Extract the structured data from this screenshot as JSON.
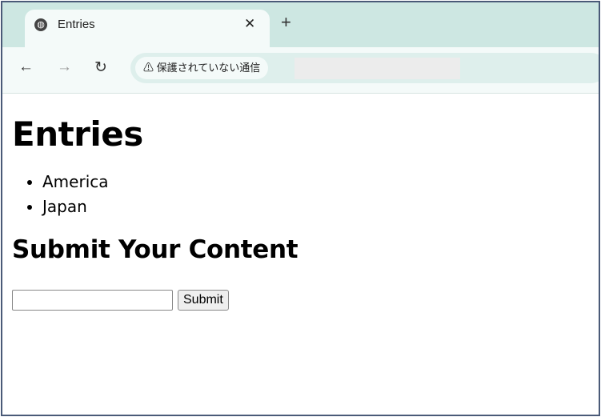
{
  "browser": {
    "tab_title": "Entries",
    "security_label": "保護されていない通信",
    "address": ""
  },
  "page": {
    "heading": "Entries",
    "entries": [
      "America",
      "Japan"
    ],
    "form_heading": "Submit Your Content",
    "input_value": "",
    "submit_label": "Submit"
  }
}
